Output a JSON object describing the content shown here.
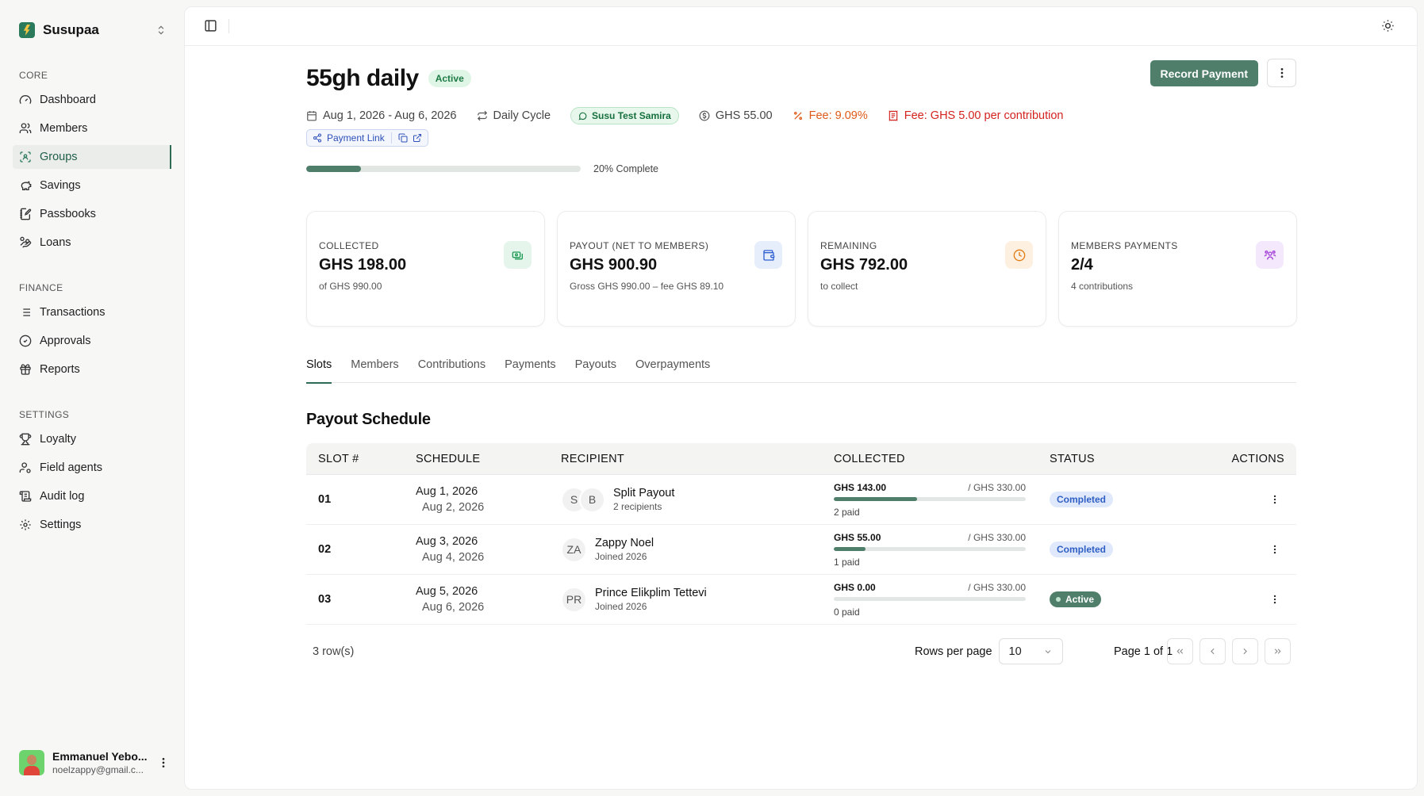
{
  "brand": {
    "name": "Susupaa"
  },
  "nav": {
    "core": {
      "title": "CORE",
      "items": [
        {
          "label": "Dashboard",
          "icon": "dashboard-icon"
        },
        {
          "label": "Members",
          "icon": "users-icon"
        },
        {
          "label": "Groups",
          "icon": "groups-icon",
          "active": true
        },
        {
          "label": "Savings",
          "icon": "piggy-bank-icon"
        },
        {
          "label": "Passbooks",
          "icon": "notebook-icon"
        },
        {
          "label": "Loans",
          "icon": "hand-coins-icon"
        }
      ]
    },
    "finance": {
      "title": "FINANCE",
      "items": [
        {
          "label": "Transactions",
          "icon": "list-icon"
        },
        {
          "label": "Approvals",
          "icon": "check-circle-icon"
        },
        {
          "label": "Reports",
          "icon": "report-icon"
        }
      ]
    },
    "settings": {
      "title": "SETTINGS",
      "items": [
        {
          "label": "Loyalty",
          "icon": "trophy-icon"
        },
        {
          "label": "Field agents",
          "icon": "user-cog-icon"
        },
        {
          "label": "Audit log",
          "icon": "audit-log-icon"
        },
        {
          "label": "Settings",
          "icon": "gear-icon"
        }
      ]
    }
  },
  "user": {
    "name": "Emmanuel Yebo...",
    "email": "noelzappy@gmail.c..."
  },
  "group": {
    "title": "55gh daily",
    "status": "Active",
    "date_range": "Aug 1, 2026 - Aug 6, 2026",
    "cycle": "Daily Cycle",
    "whatsapp_group": "Susu Test Samira",
    "amount": "GHS 55.00",
    "fee_percent": "Fee: 9.09%",
    "fee_per_contribution": "Fee: GHS 5.00 per contribution",
    "payment_link": "Payment Link",
    "progress_fraction": 0.2,
    "progress_text": "20% Complete"
  },
  "actions": {
    "record_payment": "Record Payment"
  },
  "cards": [
    {
      "label": "COLLECTED",
      "value": "GHS 198.00",
      "sub": "of GHS 990.00",
      "icon": "cash-icon",
      "bg": "#e6f5ec",
      "color": "#1f9a55"
    },
    {
      "label": "PAYOUT (NET TO MEMBERS)",
      "value": "GHS 900.90",
      "sub": "Gross GHS 990.00 – fee GHS 89.10",
      "icon": "wallet-icon",
      "bg": "#e6eefc",
      "color": "#2f5fd0"
    },
    {
      "label": "REMAINING",
      "value": "GHS 792.00",
      "sub": "to collect",
      "icon": "clock-icon",
      "bg": "#fdf0e1",
      "color": "#e27a12"
    },
    {
      "label": "MEMBERS PAYMENTS",
      "value": "2/4",
      "sub": "4 contributions",
      "icon": "members-icon",
      "bg": "#f4e8fc",
      "color": "#a23fd6"
    }
  ],
  "tabs": [
    "Slots",
    "Members",
    "Contributions",
    "Payments",
    "Payouts",
    "Overpayments"
  ],
  "section_title": "Payout Schedule",
  "table": {
    "headers": [
      "SLOT #",
      "SCHEDULE",
      "RECIPIENT",
      "COLLECTED",
      "STATUS",
      "ACTIONS"
    ],
    "rows": [
      {
        "slot": "01",
        "start": "Aug 1, 2026",
        "end": "Aug 2, 2026",
        "avatars": [
          "S",
          "B"
        ],
        "name": "Split Payout",
        "sub": "2 recipients",
        "collected": "GHS 143.00",
        "total": "/ GHS 330.00",
        "fraction": 0.433,
        "paid": "2 paid",
        "status": "Completed"
      },
      {
        "slot": "02",
        "start": "Aug 3, 2026",
        "end": "Aug 4, 2026",
        "avatars": [
          "ZA"
        ],
        "name": "Zappy Noel",
        "sub": "Joined 2026",
        "collected": "GHS 55.00",
        "total": "/ GHS 330.00",
        "fraction": 0.167,
        "paid": "1 paid",
        "status": "Completed"
      },
      {
        "slot": "03",
        "start": "Aug 5, 2026",
        "end": "Aug 6, 2026",
        "avatars": [
          "PR"
        ],
        "name": "Prince Elikplim Tettevi",
        "sub": "Joined 2026",
        "collected": "GHS 0.00",
        "total": "/ GHS 330.00",
        "fraction": 0,
        "paid": "0 paid",
        "status": "Active"
      }
    ]
  },
  "pagination": {
    "row_count": "3 row(s)",
    "rows_per_page_label": "Rows per page",
    "rows_per_page_value": "10",
    "page_info": "Page 1 of 1"
  }
}
